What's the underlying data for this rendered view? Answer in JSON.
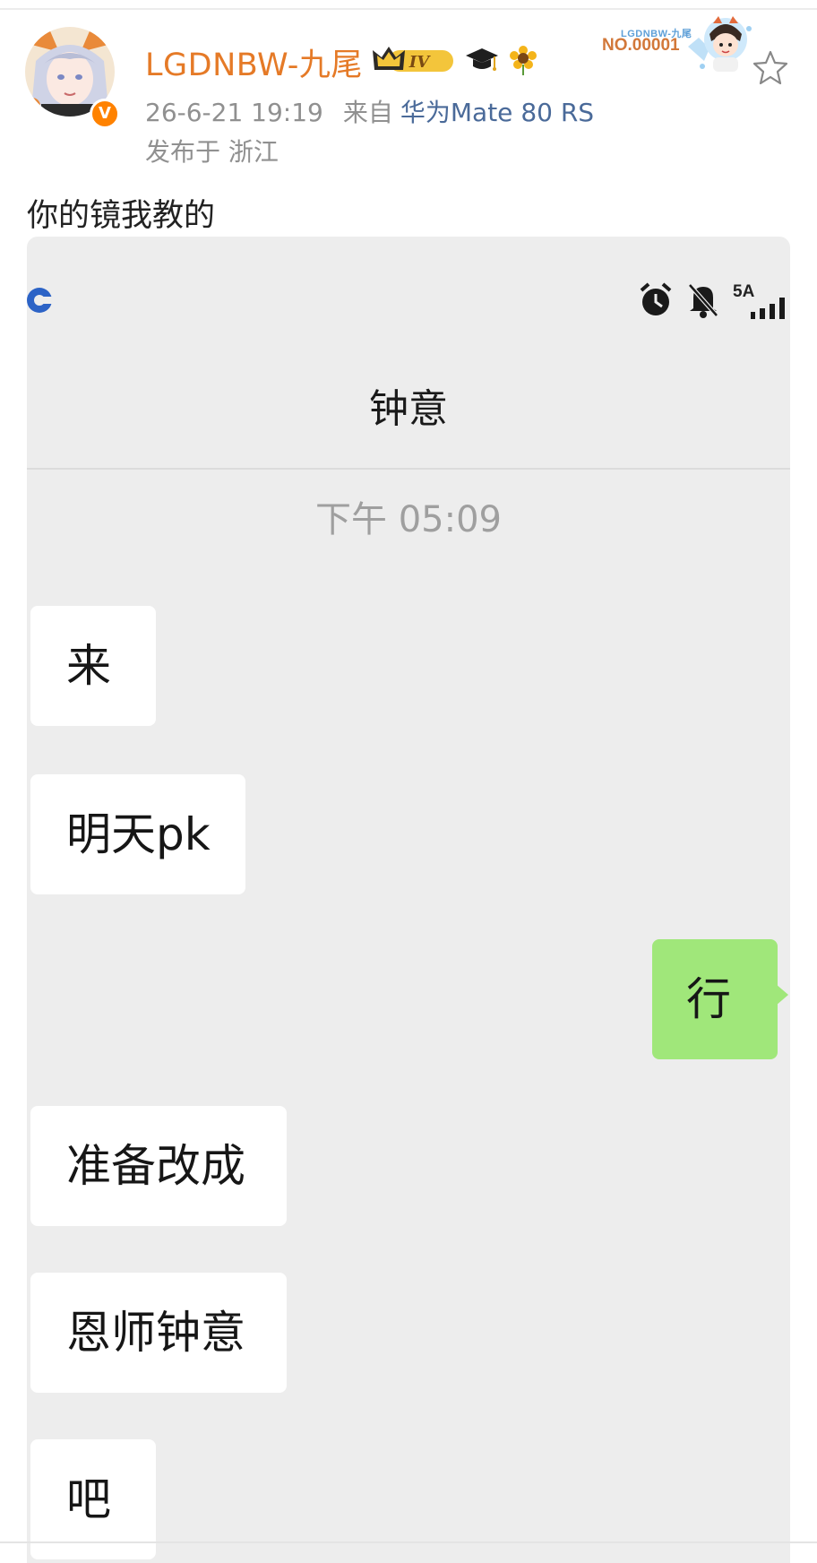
{
  "post": {
    "username": "LGDNBW-九尾",
    "vip_level": "IV",
    "timestamp": "26-6-21 19:19",
    "source_label": "来自",
    "device": "华为Mate 80 RS",
    "location": "发布于 浙江",
    "text": "你的镜我教的",
    "fan_card_title": "LGDNBW-九尾",
    "fan_card_number": "NO.00001"
  },
  "screenshot": {
    "status_bar": {
      "network": "5A"
    },
    "chat_title": "钟意",
    "time_label": "下午 05:09",
    "messages": [
      {
        "side": "in",
        "text": "来"
      },
      {
        "side": "in",
        "text": "明天pk"
      },
      {
        "side": "out",
        "text": "行"
      },
      {
        "side": "in",
        "text": "准备改成"
      },
      {
        "side": "in",
        "text": "恩师钟意"
      },
      {
        "side": "in",
        "text": "吧"
      }
    ]
  },
  "colors": {
    "username": "#e57a27",
    "device_link": "#4a6a99",
    "incoming_bubble": "#ffffff",
    "outgoing_bubble": "#a0e77a",
    "chat_background": "#ededed",
    "verified_badge": "#ff8200"
  },
  "icons": [
    "verified-badge-icon",
    "crown-icon",
    "graduation-cap-icon",
    "sunflower-icon",
    "star-icon",
    "app-logo-icon",
    "alarm-icon",
    "mute-icon",
    "signal-icon"
  ]
}
